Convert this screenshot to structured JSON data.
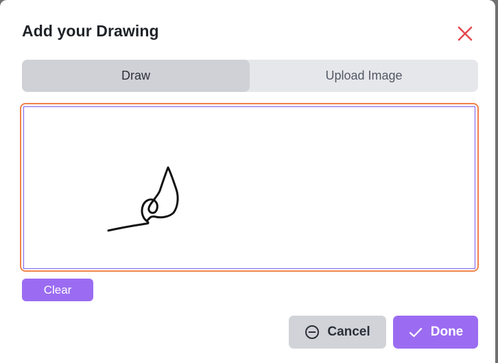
{
  "dialog": {
    "title": "Add your Drawing",
    "close_icon": "close-icon",
    "close_color": "#e5484d"
  },
  "tabs": [
    {
      "label": "Draw",
      "active": true
    },
    {
      "label": "Upload Image",
      "active": false
    }
  ],
  "canvas": {
    "focus_color": "#f08248",
    "border_color": "#7a5cf0"
  },
  "actions": {
    "clear_label": "Clear",
    "cancel_label": "Cancel",
    "cancel_icon": "minus-circle-icon",
    "done_label": "Done",
    "done_icon": "check-icon",
    "accent_color": "#9b6cf2"
  }
}
